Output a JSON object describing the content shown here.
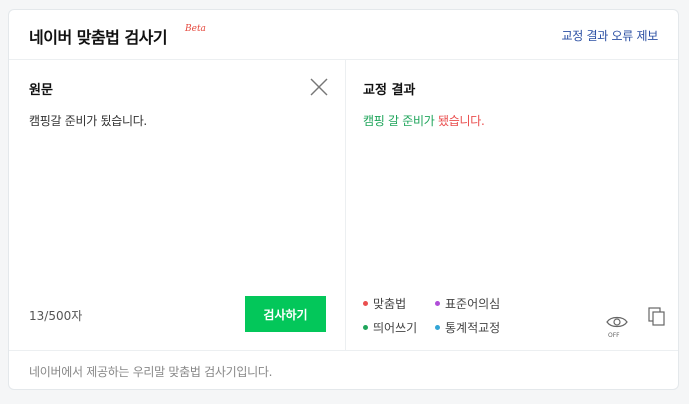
{
  "header": {
    "title": "네이버 맞춤법 검사기",
    "beta": "Beta",
    "report_link": "교정 결과 오류 제보"
  },
  "source_panel": {
    "title": "원문",
    "text": "캠핑갈 준비가 됬습니다.",
    "char_count": "13/500자",
    "check_button": "검사하기"
  },
  "result_panel": {
    "title": "교정 결과",
    "segments": [
      {
        "text": "캠핑 갈",
        "type": "standard"
      },
      {
        "text": " 준비가 ",
        "type": "standard"
      },
      {
        "text": "됐습니다.",
        "type": "spelling"
      }
    ],
    "legend": [
      {
        "label": "맞춤법",
        "color": "#ea4f4f"
      },
      {
        "label": "표준어의심",
        "color": "#b04ed8"
      },
      {
        "label": "띄어쓰기",
        "color": "#1fa55b"
      },
      {
        "label": "통계적교정",
        "color": "#33a5d6"
      }
    ],
    "eye_toggle_label": "OFF"
  },
  "footer": {
    "text": "네이버에서 제공하는 우리말 맞춤법 검사기입니다."
  }
}
